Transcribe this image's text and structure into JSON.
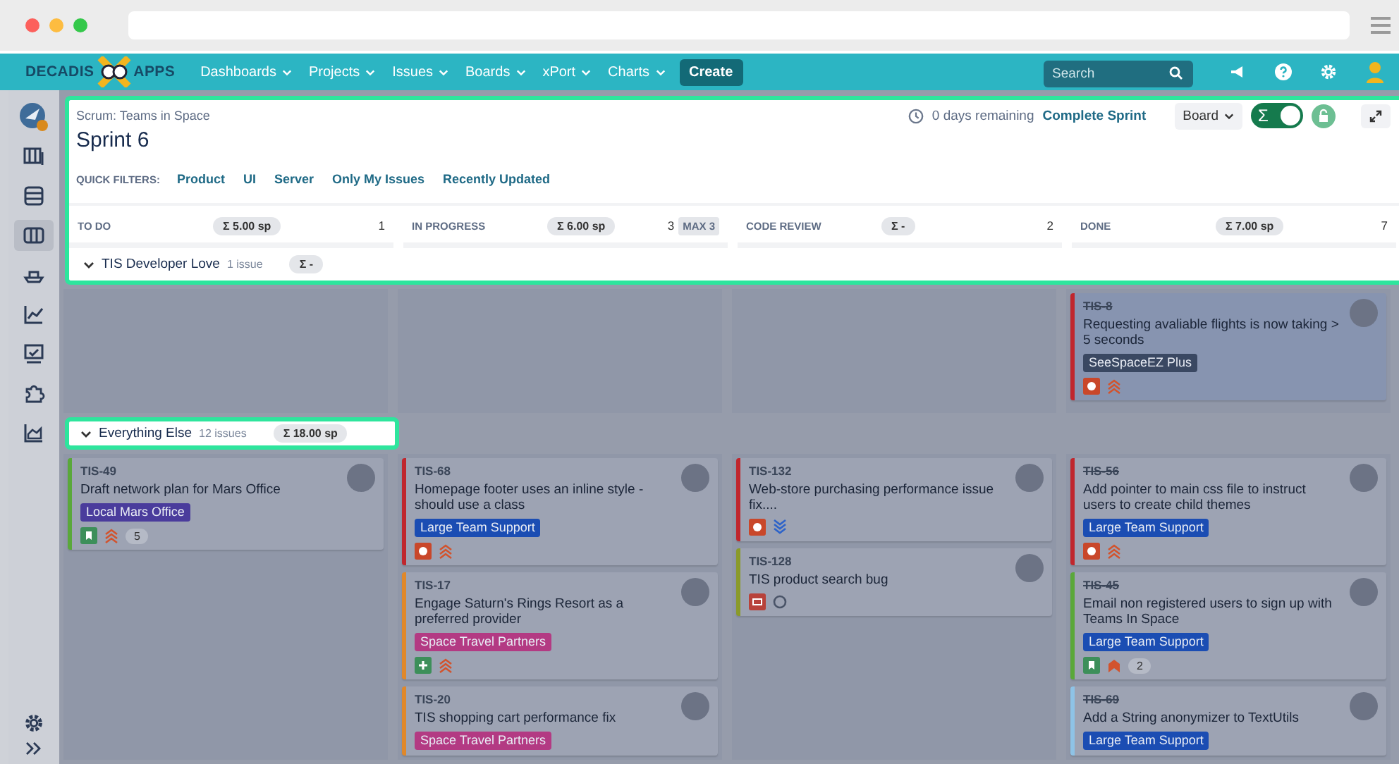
{
  "nav": {
    "logo_left": "DECADIS",
    "logo_right": "APPS",
    "menus": [
      {
        "label": "Dashboards"
      },
      {
        "label": "Projects"
      },
      {
        "label": "Issues"
      },
      {
        "label": "Boards"
      },
      {
        "label": "xPort"
      },
      {
        "label": "Charts"
      }
    ],
    "create": "Create",
    "search": {
      "placeholder": "Search"
    }
  },
  "sidebar": {
    "items": [
      {
        "kind": "project",
        "selected": false
      },
      {
        "kind": "roadmap",
        "selected": false
      },
      {
        "kind": "backlog",
        "selected": false
      },
      {
        "kind": "board",
        "selected": true
      },
      {
        "kind": "releases",
        "selected": false
      },
      {
        "kind": "reports",
        "selected": false
      },
      {
        "kind": "tests",
        "selected": false
      },
      {
        "kind": "components",
        "selected": false
      },
      {
        "kind": "chart",
        "selected": false
      }
    ]
  },
  "header": {
    "project": "Scrum: Teams in Space",
    "sprint": "Sprint 6",
    "remaining": "0 days remaining",
    "complete": "Complete Sprint",
    "view": "Board",
    "sum_toggle": {
      "symbol": "Σ",
      "on": true
    },
    "quick_filters_label": "QUICK FILTERS:",
    "quick_filters": [
      {
        "label": "Product"
      },
      {
        "label": "UI"
      },
      {
        "label": "Server"
      },
      {
        "label": "Only My Issues"
      },
      {
        "label": "Recently Updated"
      }
    ]
  },
  "columns": [
    {
      "name": "TO DO",
      "sum": "Σ 5.00 sp",
      "count": "1"
    },
    {
      "name": "IN PROGRESS",
      "sum": "Σ 6.00 sp",
      "count": "3",
      "max": "MAX 3"
    },
    {
      "name": "CODE REVIEW",
      "sum": "Σ -",
      "count": "2"
    },
    {
      "name": "DONE",
      "sum": "Σ 7.00 sp",
      "count": "7"
    }
  ],
  "swimlanes": [
    {
      "title": "TIS Developer Love",
      "count": "1 issue",
      "sum": "Σ -",
      "expanded": true,
      "highlighted": true,
      "cells": [
        [],
        [],
        [],
        [
          {
            "key": "TIS-8",
            "done": true,
            "summary": "Requesting avaliable flights is now taking > 5 seconds",
            "label": {
              "text": "SeeSpaceEZ Plus",
              "color": "#3a4862"
            },
            "icons": [
              {
                "kind": "bug"
              },
              {
                "kind": "highest"
              }
            ],
            "color": "#c0262d",
            "selected": true
          }
        ]
      ]
    },
    {
      "title": "Everything Else",
      "count": "12 issues",
      "sum": "Σ 18.00 sp",
      "expanded": true,
      "highlighted": true,
      "cells": [
        [
          {
            "key": "TIS-49",
            "done": false,
            "summary": "Draft network plan for Mars Office",
            "label": {
              "text": "Local Mars Office",
              "color": "#4a3c9c"
            },
            "icons": [
              {
                "kind": "story"
              },
              {
                "kind": "highest"
              }
            ],
            "estimate": "5",
            "color": "#5aa83a",
            "selected": false
          }
        ],
        [
          {
            "key": "TIS-68",
            "done": false,
            "summary": "Homepage footer uses an inline style - should use a class",
            "label": {
              "text": "Large Team Support",
              "color": "#1b4db3"
            },
            "icons": [
              {
                "kind": "bug"
              },
              {
                "kind": "highest"
              }
            ],
            "color": "#c0262d",
            "selected": false
          },
          {
            "key": "TIS-17",
            "done": false,
            "summary": "Engage Saturn's Rings Resort as a preferred provider",
            "label": {
              "text": "Space Travel Partners",
              "color": "#b33a83"
            },
            "icons": [
              {
                "kind": "feature"
              },
              {
                "kind": "highest"
              }
            ],
            "color": "#e0882a",
            "selected": false
          },
          {
            "key": "TIS-20",
            "done": false,
            "summary": "TIS shopping cart performance fix",
            "label": {
              "text": "Space Travel Partners",
              "color": "#b33a83"
            },
            "color": "#e0882a",
            "selected": false
          }
        ],
        [
          {
            "key": "TIS-132",
            "done": false,
            "summary": "Web-store purchasing performance issue fix....",
            "icons": [
              {
                "kind": "bug"
              },
              {
                "kind": "lowest"
              }
            ],
            "color": "#c0262d",
            "selected": false
          },
          {
            "key": "TIS-128",
            "done": false,
            "summary": "TIS product search bug",
            "icons": [
              {
                "kind": "support"
              },
              {
                "kind": "none"
              }
            ],
            "color": "#8a9a2a",
            "selected": false
          }
        ],
        [
          {
            "key": "TIS-56",
            "done": true,
            "summary": "Add pointer to main css file to instruct users to create child themes",
            "label": {
              "text": "Large Team Support",
              "color": "#1b4db3"
            },
            "icons": [
              {
                "kind": "bug"
              },
              {
                "kind": "highest"
              }
            ],
            "color": "#c0262d",
            "selected": false
          },
          {
            "key": "TIS-45",
            "done": true,
            "summary": "Email non registered users to sign up with Teams In Space",
            "label": {
              "text": "Large Team Support",
              "color": "#1b4db3"
            },
            "icons": [
              {
                "kind": "story"
              },
              {
                "kind": "major"
              }
            ],
            "estimate": "2",
            "color": "#5aa83a",
            "selected": false
          },
          {
            "key": "TIS-69",
            "done": true,
            "summary": "Add a String anonymizer to TextUtils",
            "label": {
              "text": "Large Team Support",
              "color": "#1b4db3"
            },
            "color": "#8ec3e6",
            "selected": false
          }
        ]
      ]
    }
  ]
}
